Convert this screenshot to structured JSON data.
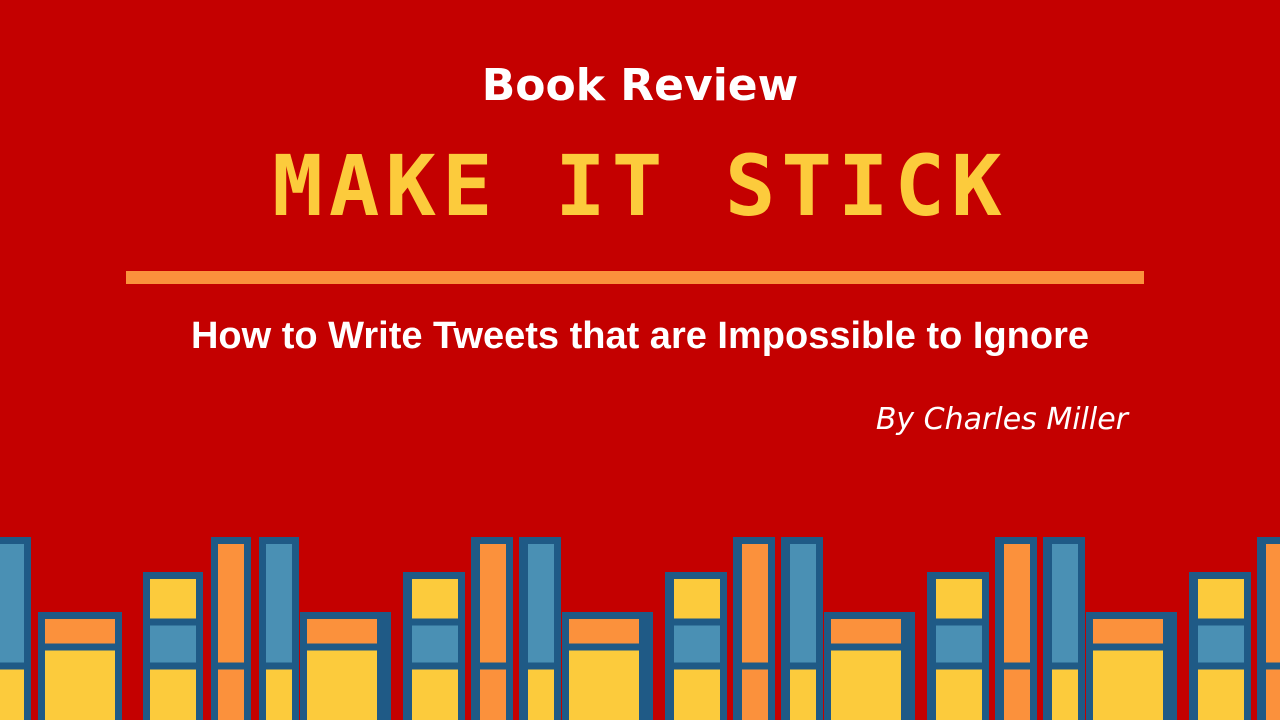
{
  "cover": {
    "kicker": "Book Review",
    "title": "MAKE IT STICK",
    "subtitle": "How to Write Tweets that are Impossible to Ignore",
    "byline": "By Charles Miller"
  },
  "colors": {
    "background": "#c40000",
    "title": "#fccb3c",
    "rule": "#fb913c",
    "text": "#ffffff",
    "book_outline": "#1f5a86",
    "book_blue": "#4a90b4",
    "book_orange": "#fb913c",
    "book_yellow": "#fccb3c"
  },
  "icons": {
    "bookshelf": "bookshelf-icon"
  }
}
